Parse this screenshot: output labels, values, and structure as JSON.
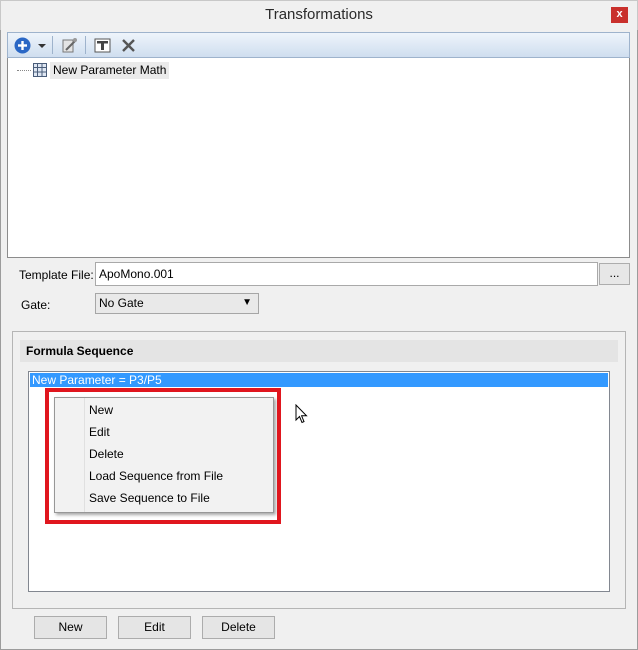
{
  "window": {
    "title": "Transformations",
    "close_label": "x"
  },
  "toolbar": {
    "icons": [
      "add-icon",
      "dropdown-arrow-icon",
      "wizard-icon",
      "rename-icon",
      "delete-icon"
    ]
  },
  "tree": {
    "items": [
      {
        "label": "New Parameter Math",
        "icon": "parameter-math-icon"
      }
    ]
  },
  "template": {
    "label": "Template File:",
    "value": "ApoMono.001",
    "browse_label": "..."
  },
  "gate": {
    "label": "Gate:",
    "value": "No Gate"
  },
  "formula": {
    "header": "Formula Sequence",
    "items": [
      "New Parameter = P3/P5"
    ]
  },
  "context_menu": {
    "items": [
      "New",
      "Edit",
      "Delete",
      "Load Sequence from File",
      "Save Sequence to File"
    ]
  },
  "buttons": {
    "new": "New",
    "edit": "Edit",
    "delete": "Delete"
  },
  "colors": {
    "selection": "#3399ff",
    "highlight": "#e0161e",
    "close": "#c9302c"
  }
}
